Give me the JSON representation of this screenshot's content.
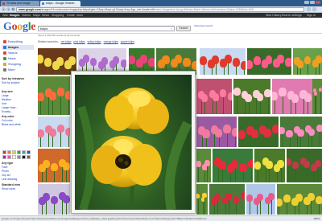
{
  "browser": {
    "tabs": [
      {
        "label": "Tif data and image"
      },
      {
        "label": "tulips - Google Search"
      }
    ],
    "url_host": "www.google.com",
    "url_path": "/images?hl=en&source=imghp&q=tulips&gbv=2&aq=f&aqi=g10&aql=&oq=&gs_rfai=&safe=off",
    "url_rest": "#start=&imgrefurl=&usg=&tbnid=&tbnh=&tbnw=&hl=en&sa=X&biw=1259&bih=628"
  },
  "google_bar": {
    "items": [
      "Web",
      "Images",
      "Videos",
      "Maps",
      "News",
      "Shopping",
      "Gmail",
      "more"
    ],
    "active": "Images",
    "right_links": [
      "Web History",
      "Search settings",
      "Sign in"
    ]
  },
  "search": {
    "logo": {
      "b": "G",
      "r": "o",
      "y": "o",
      "b2": "g",
      "g": "l",
      "r2": "e"
    },
    "query": "tulips",
    "clear": "×",
    "button_label": "Search",
    "advanced_label": "Advanced search",
    "result_stats": "About 1,040,000 results (0.26 seconds)"
  },
  "related": {
    "label": "Related searches:",
    "links": [
      "red tulips",
      "pink tulips",
      "yellow tulips",
      "orange tulips",
      "purple tulips"
    ]
  },
  "sidebar": {
    "types": [
      {
        "label": "Everything",
        "color": "#d8473a"
      },
      {
        "label": "Images",
        "color": "#3a6fd8"
      },
      {
        "label": "Videos",
        "color": "#d8473a"
      },
      {
        "label": "News",
        "color": "#3a9a4a"
      },
      {
        "label": "Shopping",
        "color": "#e2a80f"
      },
      {
        "label": "More",
        "color": "#777777"
      }
    ],
    "active_type": "Images",
    "sort": {
      "heading": "Sort by relevance",
      "link": "Sort by subject"
    },
    "size": {
      "heading": "Any size",
      "options": [
        "Large",
        "Medium",
        "Icon",
        "Larger than...",
        "Exactly..."
      ]
    },
    "color": {
      "heading": "Any color",
      "options": [
        "Full color",
        "Black and white"
      ]
    },
    "swatch_colors": [
      "#d8322a",
      "#e5822a",
      "#e8d232",
      "#3a9a3a",
      "#2aa8c8",
      "#2a4ad8",
      "#8a2ad8",
      "#e85aa8",
      "#ffffff",
      "#8a8a8a",
      "#111111",
      "#8a5a2a"
    ],
    "type": {
      "heading": "Any type",
      "options": [
        "Face",
        "Photo",
        "Clip art",
        "Line drawing"
      ]
    },
    "view": {
      "heading": "Standard view",
      "link": "Show sizes"
    }
  },
  "status": {
    "text": "google.com/imgres?imgurl=http://www.thebestlinks.com/images/wallpapers/14/14_wallpaper_tulips.jpg&imgrefurl=http://www.thebestlinks.com/Tulip.html&usg=&h=768&w=1024&sz=132&hl=en",
    "zoom": "100%"
  }
}
